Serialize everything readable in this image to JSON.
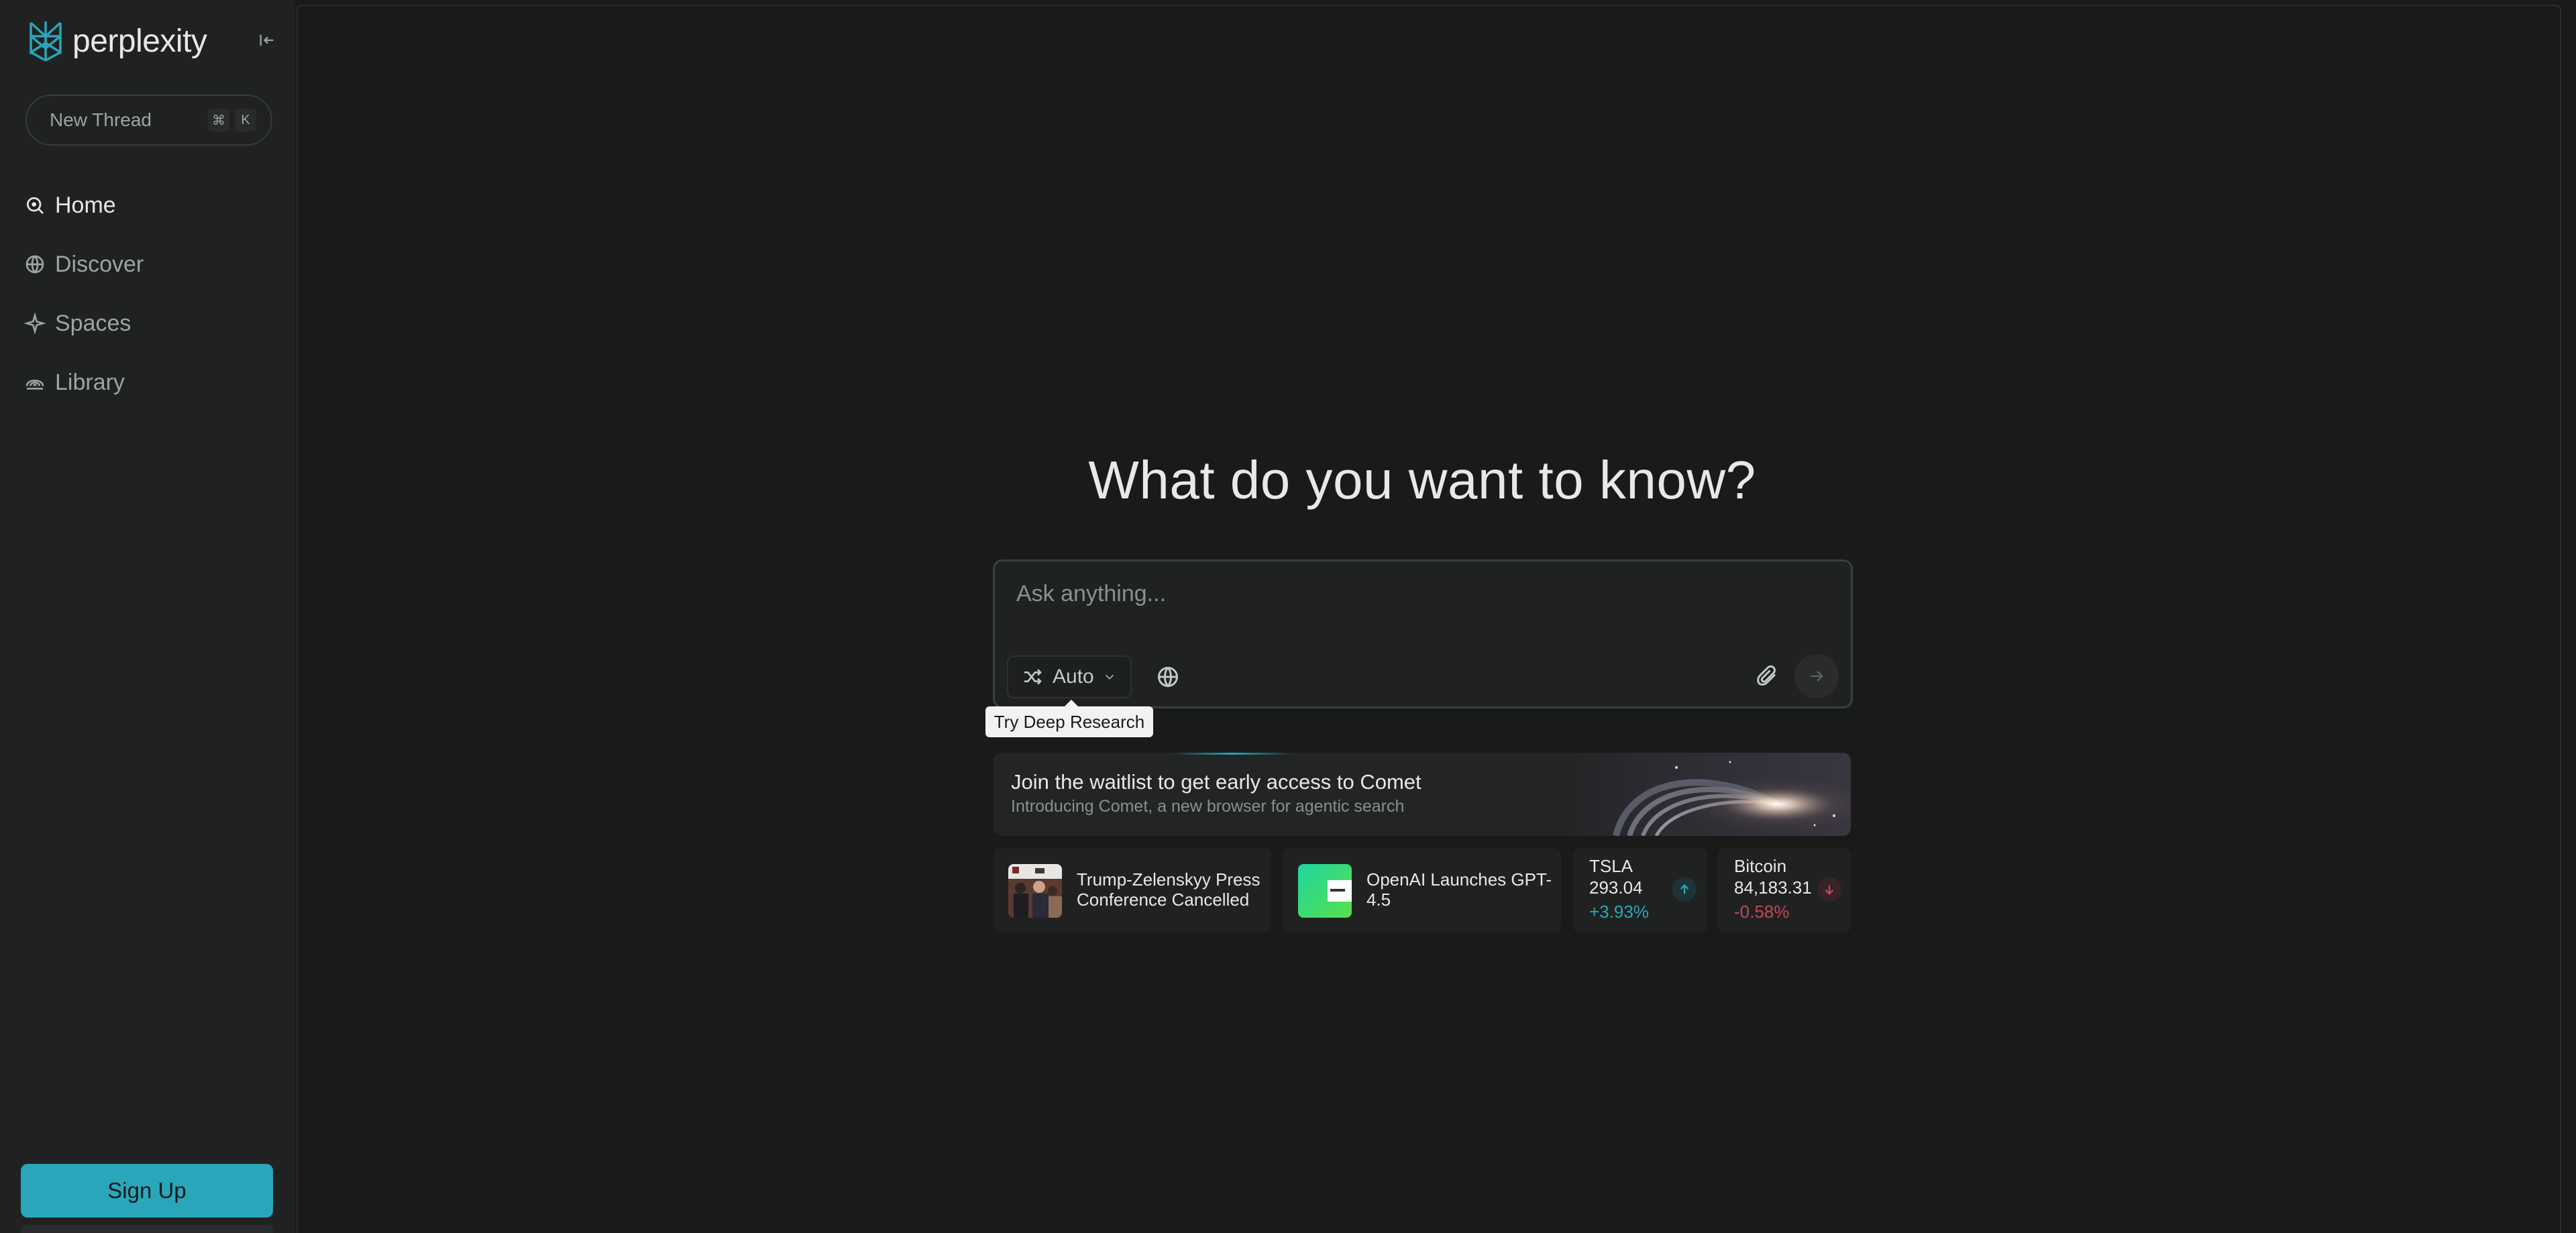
{
  "sidebar": {
    "logo_text": "perplexity",
    "new_thread": {
      "label": "New Thread",
      "shortcut_keys": [
        "⌘",
        "K"
      ]
    },
    "nav": [
      {
        "label": "Home",
        "icon": "search-icon",
        "active": true
      },
      {
        "label": "Discover",
        "icon": "globe-icon",
        "active": false
      },
      {
        "label": "Spaces",
        "icon": "sparkle-icon",
        "active": false
      },
      {
        "label": "Library",
        "icon": "library-icon",
        "active": false
      }
    ],
    "signup_label": "Sign Up"
  },
  "main": {
    "headline": "What do you want to know?",
    "search": {
      "placeholder": "Ask anything...",
      "value": "",
      "mode_label": "Auto"
    },
    "tooltip": "Try Deep Research",
    "comet": {
      "title": "Join the waitlist to get early access to Comet",
      "subtitle": "Introducing Comet, a new browser for agentic search"
    },
    "tiles": {
      "news1": {
        "text_line1": "Trump-Zelenskyy Press",
        "text_line2": "Conference Cancelled"
      },
      "news2": {
        "text_line1": "OpenAI Launches GPT-",
        "text_line2": "4.5"
      },
      "stock1": {
        "name": "TSLA",
        "price": "293.04",
        "change": "+3.93%",
        "direction": "up"
      },
      "stock2": {
        "name": "Bitcoin",
        "price": "84,183.31",
        "change": "-0.58%",
        "direction": "down"
      }
    }
  },
  "colors": {
    "accent": "#2aa6ba",
    "positive": "#2aa6ba",
    "negative": "#c0475a",
    "background": "#191a1a",
    "sidebar": "#202222"
  }
}
